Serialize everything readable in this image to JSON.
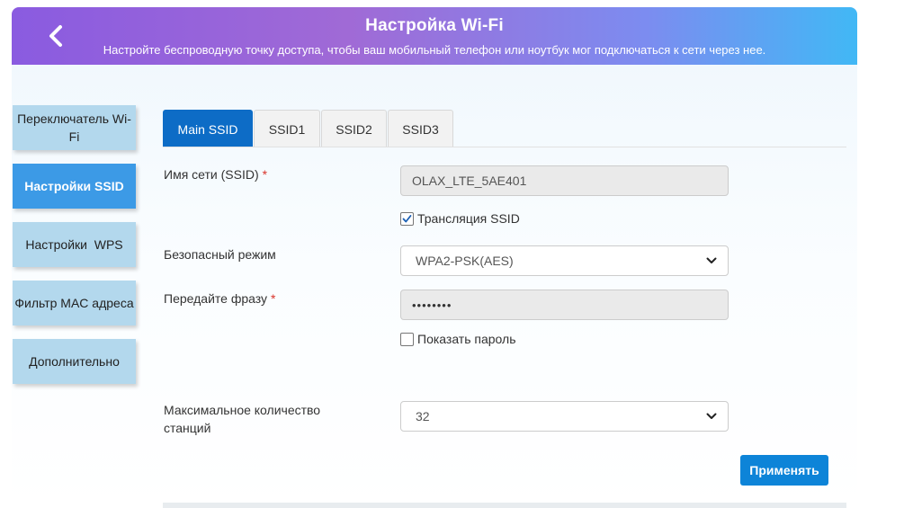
{
  "header": {
    "title": "Настройка Wi-Fi",
    "subtitle": "Настройте беспроводную точку доступа, чтобы ваш мобильный телефон или ноутбук мог подключаться к сети через нее."
  },
  "sidebar": {
    "items": [
      {
        "label": "Переключатель Wi-Fi",
        "active": false
      },
      {
        "label": "Настройки SSID",
        "active": true
      },
      {
        "label": "Настройки  WPS",
        "active": false
      },
      {
        "label": "Фильтр MAC адреса",
        "active": false
      },
      {
        "label": "Дополнительно",
        "active": false
      }
    ]
  },
  "tabs": [
    {
      "label": "Main SSID",
      "active": true
    },
    {
      "label": "SSID1",
      "active": false
    },
    {
      "label": "SSID2",
      "active": false
    },
    {
      "label": "SSID3",
      "active": false
    }
  ],
  "form": {
    "ssid_label": "Имя сети (SSID)",
    "ssid_value": "OLAX_LTE_5AE401",
    "broadcast_label": "Трансляция SSID",
    "broadcast_checked": true,
    "security_label": "Безопасный режим",
    "security_value": "WPA2-PSK(AES)",
    "passphrase_label": "Передайте фразу",
    "passphrase_value": "••••••••",
    "show_password_label": "Показать пароль",
    "show_password_checked": false,
    "max_stations_label_line1": "Максимальное количество",
    "max_stations_label_line2": "станций",
    "max_stations_value": "32",
    "required_mark": "*"
  },
  "actions": {
    "apply_label": "Применять"
  },
  "colors": {
    "accent": "#0d6cc6",
    "sidebar_active": "#3c9ae6",
    "sidebar_inactive": "#b3d8ed",
    "apply_button": "#0d84d8",
    "required": "#d9342b"
  },
  "icons": {
    "back": "chevron-left-icon",
    "select": "chevron-down-icon",
    "check": "checkmark-icon"
  }
}
